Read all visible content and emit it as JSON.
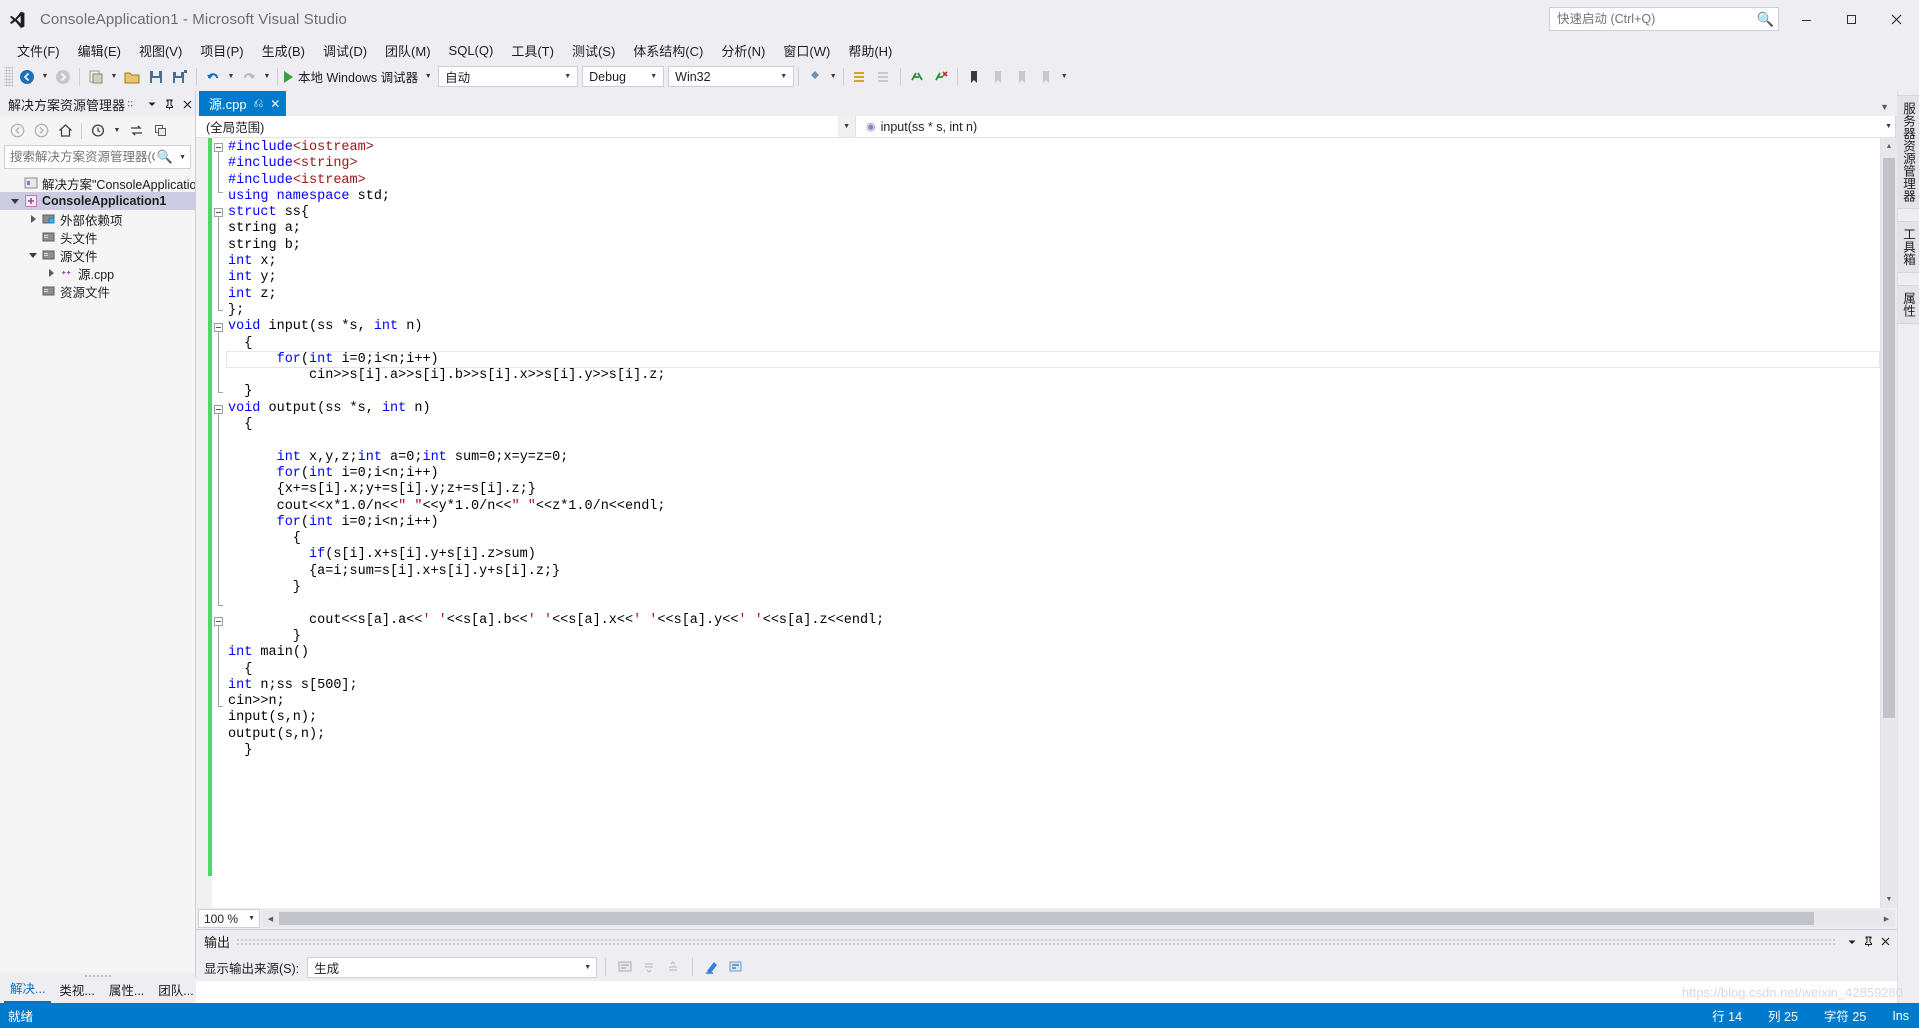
{
  "window": {
    "title": "ConsoleApplication1 - Microsoft Visual Studio",
    "logo_name": "visual-studio-logo",
    "minimize": "—",
    "maximize": "□",
    "close": "✕"
  },
  "quick_launch": {
    "placeholder": "快速启动 (Ctrl+Q)",
    "icon": "search-icon"
  },
  "menu": [
    {
      "label": "文件(F)"
    },
    {
      "label": "编辑(E)"
    },
    {
      "label": "视图(V)"
    },
    {
      "label": "项目(P)"
    },
    {
      "label": "生成(B)"
    },
    {
      "label": "调试(D)"
    },
    {
      "label": "团队(M)"
    },
    {
      "label": "SQL(Q)"
    },
    {
      "label": "工具(T)"
    },
    {
      "label": "测试(S)"
    },
    {
      "label": "体系结构(C)"
    },
    {
      "label": "分析(N)"
    },
    {
      "label": "窗口(W)"
    },
    {
      "label": "帮助(H)"
    }
  ],
  "toolbar": {
    "start_label": "本地 Windows 调试器",
    "config": "自动",
    "solution_config": "Debug",
    "solution_platform": "Win32",
    "icons": [
      "back-icon",
      "forward-icon",
      "new-project-icon",
      "open-file-icon",
      "save-icon",
      "save-all-icon",
      "undo-icon",
      "redo-icon",
      "start-debug-icon",
      "find-icon",
      "toolwindow-icon",
      "comment-icon",
      "uncomment-icon",
      "bookmark-icon",
      "outdent-icon",
      "indent-icon"
    ]
  },
  "solution_explorer": {
    "title": "解决方案资源管理器",
    "header_icons": [
      "dots-icon",
      "chevron-down-icon",
      "pin-icon",
      "close-icon"
    ],
    "toolbar_icons": [
      "back-icon",
      "forward-icon",
      "home-icon",
      "pending-changes-icon",
      "sync-icon",
      "collapse-all-icon"
    ],
    "search_placeholder": "搜索解决方案资源管理器(C",
    "search_icon": "search-icon",
    "tree": [
      {
        "label": "解决方案\"ConsoleApplicatio",
        "indent": 0,
        "twist": "none",
        "icon": "solution-icon",
        "selected": false
      },
      {
        "label": "ConsoleApplication1",
        "indent": 1,
        "twist": "down",
        "icon": "project-icon",
        "selected": true
      },
      {
        "label": "外部依赖项",
        "indent": 2,
        "twist": "right",
        "icon": "folder-deps-icon",
        "selected": false
      },
      {
        "label": "头文件",
        "indent": 2,
        "twist": "none",
        "icon": "folder-icon",
        "selected": false
      },
      {
        "label": "源文件",
        "indent": 2,
        "twist": "down",
        "icon": "folder-icon",
        "selected": false
      },
      {
        "label": "源.cpp",
        "indent": 3,
        "twist": "right",
        "icon": "cpp-file-icon",
        "selected": false
      },
      {
        "label": "资源文件",
        "indent": 2,
        "twist": "none",
        "icon": "folder-icon",
        "selected": false
      }
    ],
    "bottom_tabs": [
      {
        "label": "解决...",
        "active": true
      },
      {
        "label": "类视...",
        "active": false
      },
      {
        "label": "属性...",
        "active": false
      },
      {
        "label": "团队...",
        "active": false
      }
    ]
  },
  "editor": {
    "tab": {
      "label": "源.cpp",
      "pin": "⍑",
      "close": "✕"
    },
    "tabstrip_chevron": "chevron-down-icon",
    "nav_scope": "(全局范围)",
    "nav_member": "input(ss * s, int n)",
    "nav_member_icon": "method-icon",
    "zoom": "100 %",
    "current_line_index": 13,
    "lines": [
      [
        {
          "t": "#include",
          "c": "pp"
        },
        {
          "t": "<iostream>",
          "c": "inc"
        }
      ],
      [
        {
          "t": "#include",
          "c": "pp"
        },
        {
          "t": "<string>",
          "c": "inc"
        }
      ],
      [
        {
          "t": "#include",
          "c": "pp"
        },
        {
          "t": "<istream>",
          "c": "inc"
        }
      ],
      [
        {
          "t": "using namespace",
          "c": "kw"
        },
        {
          "t": " std;",
          "c": ""
        }
      ],
      [
        {
          "t": "struct",
          "c": "kw"
        },
        {
          "t": " ss{",
          "c": ""
        }
      ],
      [
        {
          "t": "string a;",
          "c": ""
        }
      ],
      [
        {
          "t": "string b;",
          "c": ""
        }
      ],
      [
        {
          "t": "int",
          "c": "kw"
        },
        {
          "t": " x;",
          "c": ""
        }
      ],
      [
        {
          "t": "int",
          "c": "kw"
        },
        {
          "t": " y;",
          "c": ""
        }
      ],
      [
        {
          "t": "int",
          "c": "kw"
        },
        {
          "t": " z;",
          "c": ""
        }
      ],
      [
        {
          "t": "};",
          "c": ""
        }
      ],
      [
        {
          "t": "void",
          "c": "kw"
        },
        {
          "t": " input(ss *s, ",
          "c": ""
        },
        {
          "t": "int",
          "c": "kw"
        },
        {
          "t": " n)",
          "c": ""
        }
      ],
      [
        {
          "t": "  {",
          "c": ""
        }
      ],
      [
        {
          "t": "      ",
          "c": ""
        },
        {
          "t": "for",
          "c": "kw"
        },
        {
          "t": "(",
          "c": ""
        },
        {
          "t": "int",
          "c": "kw"
        },
        {
          "t": " i=0;i<n;i++)",
          "c": ""
        }
      ],
      [
        {
          "t": "          cin>>s[i].a>>s[i].b>>s[i].x>>s[i].y>>s[i].z;",
          "c": ""
        }
      ],
      [
        {
          "t": "  }",
          "c": ""
        }
      ],
      [
        {
          "t": "void",
          "c": "kw"
        },
        {
          "t": " output(ss *s, ",
          "c": ""
        },
        {
          "t": "int",
          "c": "kw"
        },
        {
          "t": " n)",
          "c": ""
        }
      ],
      [
        {
          "t": "  {",
          "c": ""
        }
      ],
      [
        {
          "t": "",
          "c": ""
        }
      ],
      [
        {
          "t": "      ",
          "c": ""
        },
        {
          "t": "int",
          "c": "kw"
        },
        {
          "t": " x,y,z;",
          "c": ""
        },
        {
          "t": "int",
          "c": "kw"
        },
        {
          "t": " a=0;",
          "c": ""
        },
        {
          "t": "int",
          "c": "kw"
        },
        {
          "t": " sum=0;x=y=z=0;",
          "c": ""
        }
      ],
      [
        {
          "t": "      ",
          "c": ""
        },
        {
          "t": "for",
          "c": "kw"
        },
        {
          "t": "(",
          "c": ""
        },
        {
          "t": "int",
          "c": "kw"
        },
        {
          "t": " i=0;i<n;i++)",
          "c": ""
        }
      ],
      [
        {
          "t": "      {x+=s[i].x;y+=s[i].y;z+=s[i].z;}",
          "c": ""
        }
      ],
      [
        {
          "t": "      cout<<x*1.0/n<<",
          "c": ""
        },
        {
          "t": "\" \"",
          "c": "str"
        },
        {
          "t": "<<y*1.0/n<<",
          "c": ""
        },
        {
          "t": "\" \"",
          "c": "str"
        },
        {
          "t": "<<z*1.0/n<<endl;",
          "c": ""
        }
      ],
      [
        {
          "t": "      ",
          "c": ""
        },
        {
          "t": "for",
          "c": "kw"
        },
        {
          "t": "(",
          "c": ""
        },
        {
          "t": "int",
          "c": "kw"
        },
        {
          "t": " i=0;i<n;i++)",
          "c": ""
        }
      ],
      [
        {
          "t": "        {",
          "c": ""
        }
      ],
      [
        {
          "t": "          ",
          "c": ""
        },
        {
          "t": "if",
          "c": "kw"
        },
        {
          "t": "(s[i].x+s[i].y+s[i].z>sum)",
          "c": ""
        }
      ],
      [
        {
          "t": "          {a=i;sum=s[i].x+s[i].y+s[i].z;}",
          "c": ""
        }
      ],
      [
        {
          "t": "        }",
          "c": ""
        }
      ],
      [
        {
          "t": "",
          "c": ""
        }
      ],
      [
        {
          "t": "          cout<<s[a].a<<",
          "c": ""
        },
        {
          "t": "' '",
          "c": "str"
        },
        {
          "t": "<<s[a].b<<",
          "c": ""
        },
        {
          "t": "' '",
          "c": "str"
        },
        {
          "t": "<<s[a].x<<",
          "c": ""
        },
        {
          "t": "' '",
          "c": "str"
        },
        {
          "t": "<<s[a].y<<",
          "c": ""
        },
        {
          "t": "' '",
          "c": "str"
        },
        {
          "t": "<<s[a].z<<endl;",
          "c": ""
        }
      ],
      [
        {
          "t": "        }",
          "c": ""
        }
      ],
      [
        {
          "t": "int",
          "c": "kw"
        },
        {
          "t": " main()",
          "c": ""
        }
      ],
      [
        {
          "t": "  {",
          "c": ""
        }
      ],
      [
        {
          "t": "int",
          "c": "kw"
        },
        {
          "t": " n;ss s[500];",
          "c": ""
        }
      ],
      [
        {
          "t": "cin>>n;",
          "c": ""
        }
      ],
      [
        {
          "t": "input(s,n);",
          "c": ""
        }
      ],
      [
        {
          "t": "output(s,n);",
          "c": ""
        }
      ],
      [
        {
          "t": "  }",
          "c": ""
        }
      ]
    ]
  },
  "right_strip": [
    {
      "label": "服务器资源管理器"
    },
    {
      "label": "工具箱"
    },
    {
      "label": "属性"
    }
  ],
  "output_panel": {
    "title": "输出",
    "header_icons": [
      "chevron-down-icon",
      "pin-icon",
      "close-icon"
    ],
    "source_label": "显示输出来源(S):",
    "source_value": "生成",
    "toolbar_icons": [
      "find-message-icon",
      "find-next-icon",
      "find-prev-icon",
      "clear-all-icon",
      "toggle-wordwrap-icon"
    ]
  },
  "statusbar": {
    "state": "就绪",
    "line_label": "行 14",
    "col_label": "列 25",
    "char_label": "字符 25",
    "insert_label": "Ins"
  },
  "watermark": "https://blog.csdn.net/weixin_42859280",
  "colors": {
    "accent": "#007acc",
    "chrome": "#eeeef2",
    "keyword": "#0000ff",
    "string": "#a31515",
    "save_indicator": "#4cd964"
  }
}
